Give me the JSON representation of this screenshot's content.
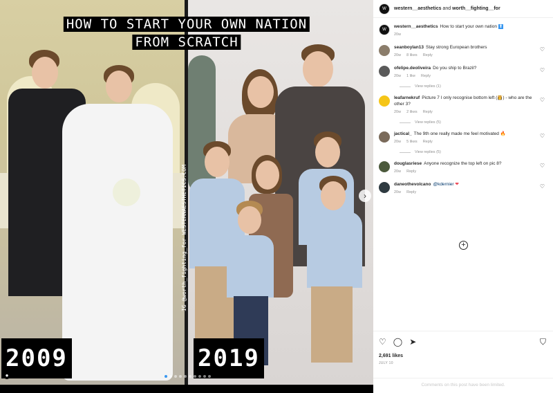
{
  "post": {
    "title_line_1": "HOW TO START YOUR OWN NATION",
    "title_line_2": "FROM SCRATCH",
    "year_left": "2009",
    "year_right": "2019",
    "watermark": "IG @worth_fighting_for WESTERNAESTHETICS.COM"
  },
  "header": {
    "users": "western__aesthetics",
    "joiner": " and ",
    "second_user": "worth__fighting__for"
  },
  "caption": {
    "user": "western__aesthetics",
    "text": "How to start your own nation",
    "emoji": "⬆",
    "age": "20w"
  },
  "comments": [
    {
      "user": "seanboylan13",
      "text": "Stay strong European brothers",
      "age": "20w",
      "likes": "8 likes",
      "reply": "Reply",
      "avatar_color": "#8b7d6b"
    },
    {
      "user": "ofelipe.deoliveira",
      "text": "Do you ship to Brazil?",
      "age": "20w",
      "likes": "1 like",
      "reply": "Reply",
      "view_replies": "View replies (1)",
      "avatar_color": "#5a5a5a"
    },
    {
      "user": "leafarnekruf",
      "text": "Picture 7 I only recognise bottom left (👸) - who are the other 3?",
      "age": "20w",
      "likes": "2 likes",
      "reply": "Reply",
      "view_replies": "View replies (5)",
      "avatar_color": "#f5c518"
    },
    {
      "user": "jactical_",
      "text": "The 9th one really made me feel motivated 🔥",
      "age": "20w",
      "likes": "5 likes",
      "reply": "Reply",
      "view_replies": "View replies (5)",
      "avatar_color": "#7a6a5a"
    },
    {
      "user": "douglasriese",
      "text": "Anyone recognize the top left on pic 8?",
      "age": "20w",
      "likes": "",
      "reply": "Reply",
      "avatar_color": "#4c5a3c"
    },
    {
      "user": "daneothevolcano",
      "text": "",
      "mention": "@kdernier",
      "heart": "❤",
      "age": "20w",
      "likes": "",
      "reply": "Reply",
      "avatar_color": "#2e3a40"
    }
  ],
  "actions": {
    "likes": "2,691 likes",
    "date": "JULY 10",
    "limited": "Comments on this post have been limited."
  },
  "icons": {
    "heart": "heart-icon",
    "comment": "comment-icon",
    "share": "share-icon",
    "bookmark": "bookmark-icon",
    "add": "plus-circle-icon",
    "next": "chevron-right-icon"
  }
}
